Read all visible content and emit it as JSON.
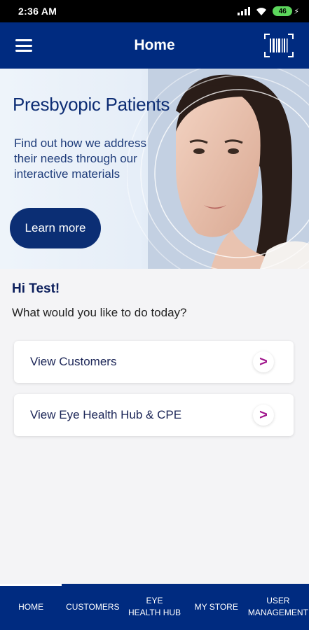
{
  "status_bar": {
    "time": "2:36 AM",
    "battery": "46"
  },
  "app_bar": {
    "title": "Home"
  },
  "banner": {
    "title": "Presbyopic Patients",
    "text": "Find out how we address their needs through our interactive materials",
    "button_label": "Learn more"
  },
  "greeting": {
    "hello": "Hi Test!",
    "question": "What would you like to do today?"
  },
  "cards": [
    {
      "label": "View Customers",
      "arrow": ">"
    },
    {
      "label": "View Eye Health Hub & CPE",
      "arrow": ">"
    }
  ],
  "bottom_nav": {
    "items": [
      {
        "line1": "HOME",
        "line2": ""
      },
      {
        "line1": "CUSTOMERS",
        "line2": ""
      },
      {
        "line1": "EYE",
        "line2": "HEALTH HUB"
      },
      {
        "line1": "MY STORE",
        "line2": ""
      },
      {
        "line1": "USER",
        "line2": "MANAGEMENT"
      }
    ],
    "active": "HOME"
  },
  "colors": {
    "primary": "#002b80",
    "accent": "#a0148c",
    "battery": "#5cd65c"
  }
}
